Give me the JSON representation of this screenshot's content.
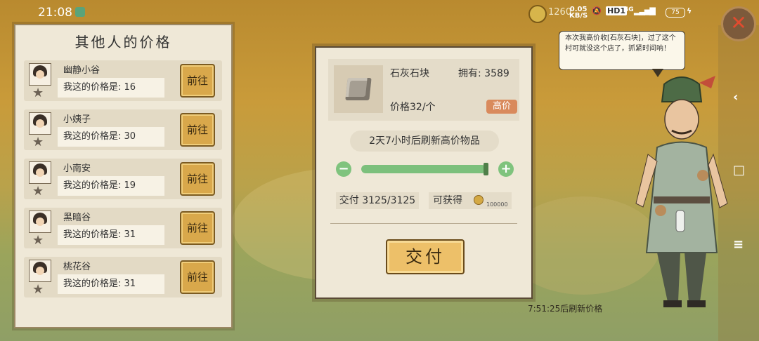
{
  "status_bar": {
    "time": "21:08",
    "coins": "1260",
    "net_speed": "0.05",
    "net_unit": "KB/S",
    "hd": "HD1",
    "signal": "4G",
    "battery": "75"
  },
  "left_panel": {
    "title": "其他人的价格",
    "go_label": "前往",
    "rows": [
      {
        "name": "幽静小谷",
        "price_text": "我这的价格是: 16"
      },
      {
        "name": "小姨子",
        "price_text": "我这的价格是: 30"
      },
      {
        "name": "小南安",
        "price_text": "我这的价格是: 19"
      },
      {
        "name": "黑暗谷",
        "price_text": "我这的价格是: 31"
      },
      {
        "name": "桃花谷",
        "price_text": "我这的价格是: 31"
      }
    ]
  },
  "item": {
    "name": "石灰石块",
    "owned": "拥有: 3589",
    "price": "价格32/个",
    "tag": "高价"
  },
  "refresh_text": "2天7小时后刷新高价物品",
  "slider_value": 1.0,
  "pay_count": "交付 3125/3125",
  "reward_label": "可获得",
  "reward_value": "100000",
  "pay_button": "交付",
  "countdown": "7:51:25后刷新价格",
  "speech": "本次我高价收[石灰石块]，过了这个村可就没这个店了，抓紧时间呐！",
  "colors": {
    "accent": "#d9a84b",
    "high_tag": "#d98a5c",
    "slider": "#7cc07c",
    "close": "#e14b2f"
  }
}
